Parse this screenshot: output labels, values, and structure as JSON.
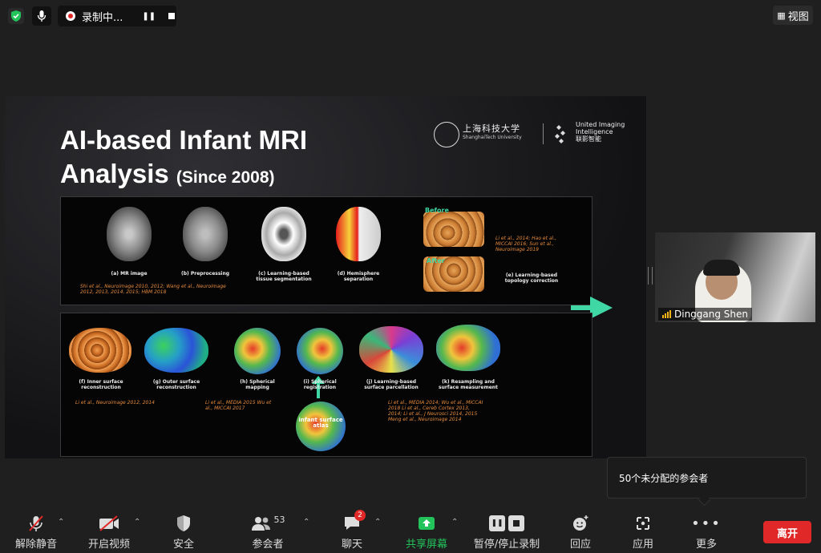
{
  "topbar": {
    "recording_label": "录制中...",
    "view_label": "视图"
  },
  "slide": {
    "title_line1": "AI-based Infant MRI",
    "title_line2": "Analysis",
    "title_since": "(Since 2008)",
    "logo_shanghaitech_cn": "上海科技大学",
    "logo_shanghaitech_en": "ShanghaiTech University",
    "logo_united_en_1": "United Imaging",
    "logo_united_en_2": "Intelligence",
    "logo_united_cn": "联影智能",
    "before_label": "Before",
    "after_label": "After",
    "infant_atlas_label": "infant surface atlas",
    "top_captions": [
      "(a) MR image",
      "(b) Preprocessing",
      "(c) Learning-based tissue segmentation",
      "(d) Hemisphere separation",
      "(e) Learning-based topology correction"
    ],
    "bottom_captions": [
      "(f) Inner surface reconstruction",
      "(g) Outer surface reconstruction",
      "(h) Spherical mapping",
      "(i) Spherical registration",
      "(j) Learning-based surface parcellation",
      "(k) Resampling and surface measurement"
    ],
    "refs": {
      "top_left": "Shi et al., Neuroimage 2010, 2012; Wang et al., Neuroimage 2012, 2013, 2014, 2015; HBM 2018",
      "top_right": "Li et al., 2014; Hao et al., MICCAI 2016; Sun et al., Neuroimage 2019",
      "bottom_1": "Li et al., Neuroimage 2012, 2014",
      "bottom_2": "Li et al., MEDIA 2015 Wu et al., MICCAI 2017",
      "bottom_3": "Li et al., MEDIA 2014; Wu et al., MICCAI 2018 Li et al., Cereb Cortex 2013, 2014; Li et al., J Neurosci 2014, 2015 Meng et al., Neuroimage 2014"
    }
  },
  "video": {
    "participant_name": "Dinggang Shen"
  },
  "popup": {
    "text": "50个未分配的参会者"
  },
  "toolbar": {
    "unmute": "解除静音",
    "start_video": "开启视频",
    "security": "安全",
    "participants": "参会者",
    "participants_count": "53",
    "chat": "聊天",
    "chat_badge": "2",
    "share": "共享屏幕",
    "pause_recording": "暂停/停止录制",
    "reactions": "回应",
    "apps": "应用",
    "more": "更多",
    "leave": "离开"
  },
  "colors": {
    "share_green": "#22c35b",
    "leave_red": "#e02828",
    "arrow_teal": "#3fd8a4",
    "ref_orange": "#e58a3d"
  }
}
